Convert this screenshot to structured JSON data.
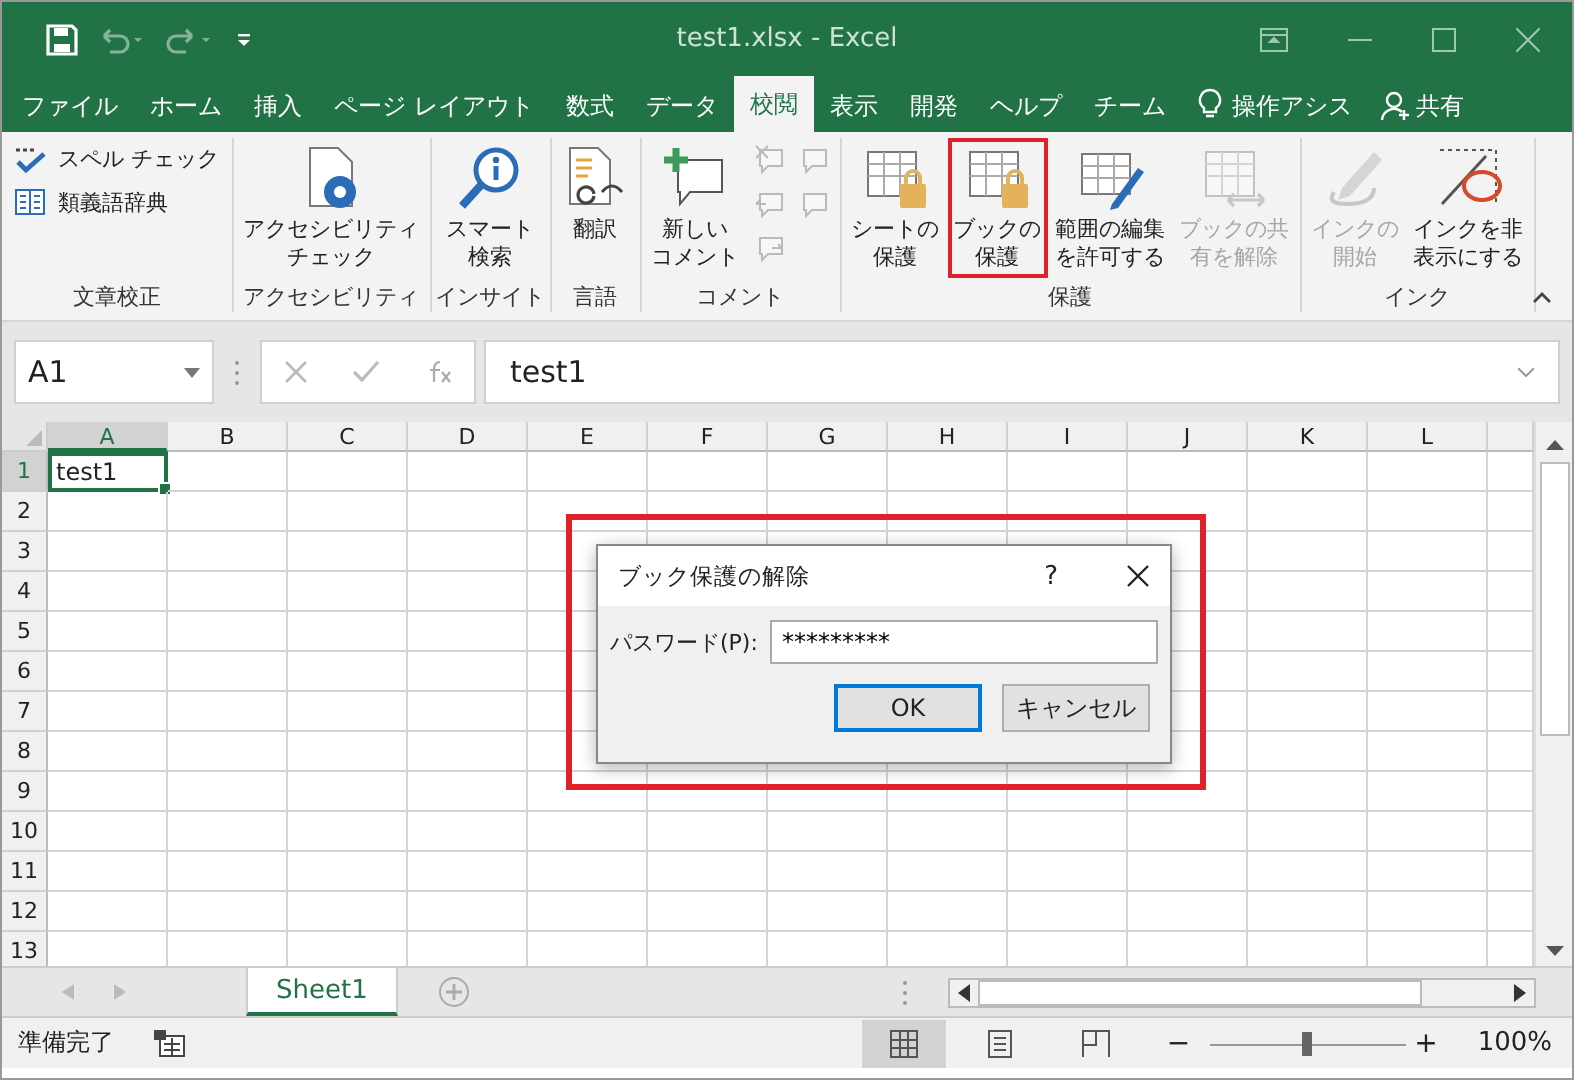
{
  "window": {
    "title": "test1.xlsx  -  Excel",
    "undo_disabled": true,
    "redo_disabled": true
  },
  "tabs": [
    {
      "label": "ファイル",
      "selected": false
    },
    {
      "label": "ホーム",
      "selected": false
    },
    {
      "label": "挿入",
      "selected": false
    },
    {
      "label": "ページ レイアウト",
      "selected": false
    },
    {
      "label": "数式",
      "selected": false
    },
    {
      "label": "データ",
      "selected": false
    },
    {
      "label": "校閲",
      "selected": true
    },
    {
      "label": "表示",
      "selected": false
    },
    {
      "label": "開発",
      "selected": false
    },
    {
      "label": "ヘルプ",
      "selected": false
    },
    {
      "label": "チーム",
      "selected": false
    }
  ],
  "tell_me": "操作アシス",
  "share": "共有",
  "ribbon": {
    "groups": [
      {
        "label": "文章校正",
        "items": [
          {
            "kind": "small",
            "label": "スペル チェック",
            "disabled": false,
            "highlighted": false
          },
          {
            "kind": "small",
            "label": "類義語辞典",
            "disabled": false,
            "highlighted": false
          }
        ]
      },
      {
        "label": "アクセシビリティ",
        "items": [
          {
            "kind": "large",
            "label": "アクセシビリティチェック",
            "disabled": false,
            "highlighted": false
          }
        ]
      },
      {
        "label": "インサイト",
        "items": [
          {
            "kind": "large",
            "label": "スマート検索",
            "disabled": false,
            "highlighted": false
          }
        ]
      },
      {
        "label": "言語",
        "items": [
          {
            "kind": "large",
            "label": "翻訳",
            "disabled": false,
            "highlighted": false
          }
        ]
      },
      {
        "label": "コメント",
        "items": [
          {
            "kind": "large",
            "label": "新しいコメント",
            "disabled": false,
            "highlighted": false
          },
          {
            "kind": "icon",
            "disabled": true,
            "highlighted": false
          },
          {
            "kind": "icon",
            "disabled": true,
            "highlighted": false
          },
          {
            "kind": "icon",
            "disabled": true,
            "highlighted": false
          },
          {
            "kind": "icon",
            "disabled": true,
            "highlighted": false
          },
          {
            "kind": "icon",
            "disabled": true,
            "highlighted": false
          }
        ]
      },
      {
        "label": "保護",
        "items": [
          {
            "kind": "large",
            "label": "シートの保護",
            "disabled": false,
            "highlighted": false
          },
          {
            "kind": "large",
            "label": "ブックの保護",
            "disabled": false,
            "highlighted": true
          },
          {
            "kind": "large",
            "label": "範囲の編集を許可する",
            "disabled": false,
            "highlighted": false
          },
          {
            "kind": "large",
            "label": "ブックの共有を解除",
            "disabled": true,
            "highlighted": false
          }
        ]
      },
      {
        "label": "インク",
        "items": [
          {
            "kind": "large",
            "label": "インクの開始",
            "disabled": true,
            "highlighted": false
          },
          {
            "kind": "large",
            "label": "インクを非表示にする",
            "disabled": false,
            "highlighted": false
          }
        ]
      }
    ]
  },
  "formula_bar": {
    "name_box": "A1",
    "value": "test1"
  },
  "sheet": {
    "columns": [
      {
        "label": "A",
        "selected": true
      },
      {
        "label": "B",
        "selected": false
      },
      {
        "label": "C",
        "selected": false
      },
      {
        "label": "D",
        "selected": false
      },
      {
        "label": "E",
        "selected": false
      },
      {
        "label": "F",
        "selected": false
      },
      {
        "label": "G",
        "selected": false
      },
      {
        "label": "H",
        "selected": false
      },
      {
        "label": "I",
        "selected": false
      },
      {
        "label": "J",
        "selected": false
      },
      {
        "label": "K",
        "selected": false
      },
      {
        "label": "L",
        "selected": false
      }
    ],
    "rows": [
      {
        "label": "1",
        "selected": true,
        "cells": [
          "test1"
        ]
      },
      {
        "label": "2",
        "selected": false,
        "cells": []
      },
      {
        "label": "3",
        "selected": false,
        "cells": []
      },
      {
        "label": "4",
        "selected": false,
        "cells": []
      },
      {
        "label": "5",
        "selected": false,
        "cells": []
      },
      {
        "label": "6",
        "selected": false,
        "cells": []
      },
      {
        "label": "7",
        "selected": false,
        "cells": []
      },
      {
        "label": "8",
        "selected": false,
        "cells": []
      },
      {
        "label": "9",
        "selected": false,
        "cells": []
      },
      {
        "label": "10",
        "selected": false,
        "cells": []
      },
      {
        "label": "11",
        "selected": false,
        "cells": []
      },
      {
        "label": "12",
        "selected": false,
        "cells": []
      },
      {
        "label": "13",
        "selected": false,
        "cells": []
      }
    ]
  },
  "dialog": {
    "title": "ブック保護の解除",
    "help": "?",
    "highlighted": true,
    "field_label": "パスワード(P):",
    "password": "*********",
    "buttons": [
      {
        "label": "OK",
        "default": true
      },
      {
        "label": "キャンセル",
        "default": false
      }
    ]
  },
  "sheet_tabs": [
    {
      "label": "Sheet1",
      "selected": true
    }
  ],
  "status_bar": {
    "text": "準備完了",
    "views": [
      {
        "kind": "normal",
        "selected": true
      },
      {
        "kind": "page_layout",
        "selected": false
      },
      {
        "kind": "page_break",
        "selected": false
      }
    ],
    "zoom": {
      "level": 0.5,
      "minus": "−",
      "plus": "+",
      "reading": "100%"
    }
  }
}
